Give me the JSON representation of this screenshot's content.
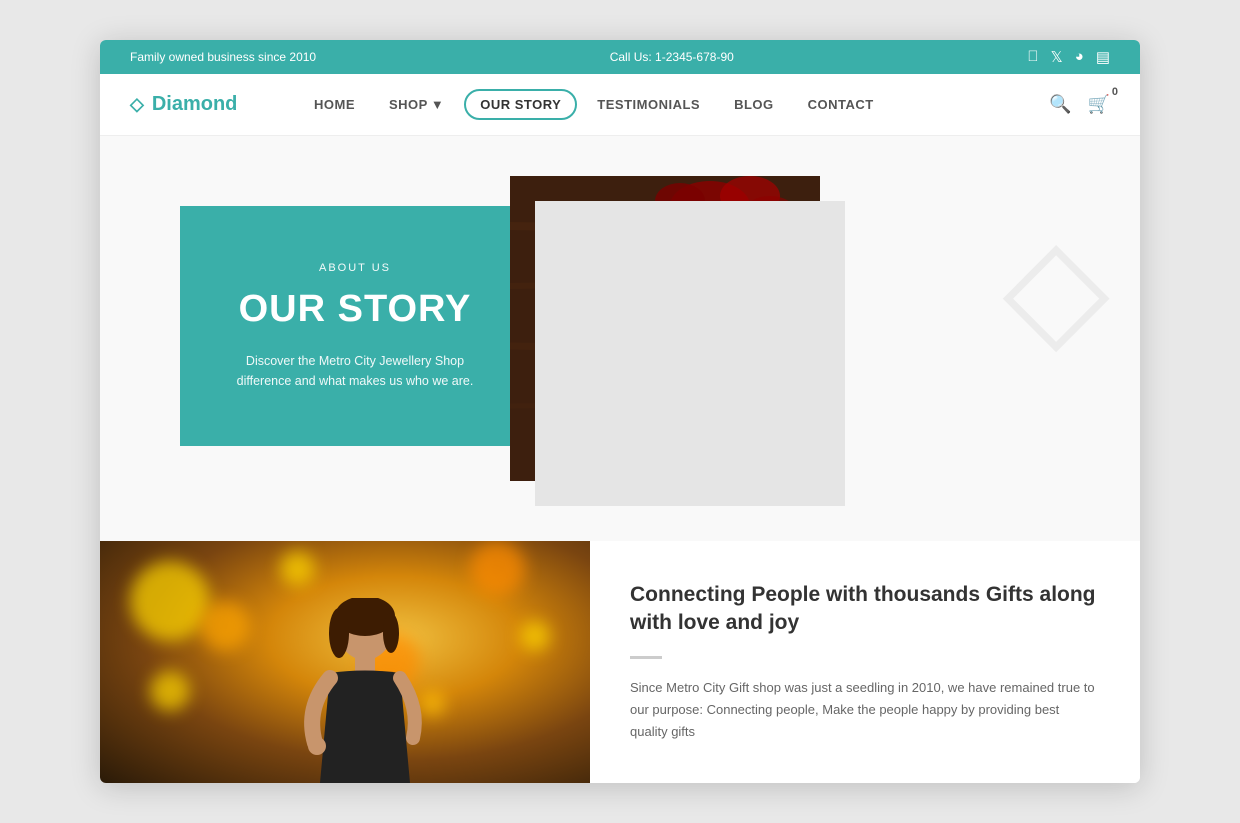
{
  "topBar": {
    "left": "Family owned business since 2010",
    "center": "Call Us: 1-2345-678-90",
    "social": [
      "facebook",
      "twitter",
      "pinterest",
      "instagram"
    ]
  },
  "nav": {
    "logo": "Diamond",
    "links": [
      {
        "label": "HOME",
        "active": false
      },
      {
        "label": "SHOP",
        "active": false,
        "hasDropdown": true
      },
      {
        "label": "OUR STORY",
        "active": true
      },
      {
        "label": "TESTIMONIALS",
        "active": false
      },
      {
        "label": "BLOG",
        "active": false
      },
      {
        "label": "CONTACT",
        "active": false
      }
    ],
    "cartCount": "0"
  },
  "hero": {
    "aboutLabel": "ABOUT US",
    "title": "OUR STORY",
    "description": "Discover the Metro City Jewellery Shop difference and what makes us who we are."
  },
  "bottomSection": {
    "heading": "Connecting People with thousands Gifts along with love and joy",
    "bodyText": "Since Metro City Gift shop was just a seedling in 2010, we have remained true to our purpose: Connecting people, Make the people happy by providing best quality gifts"
  }
}
